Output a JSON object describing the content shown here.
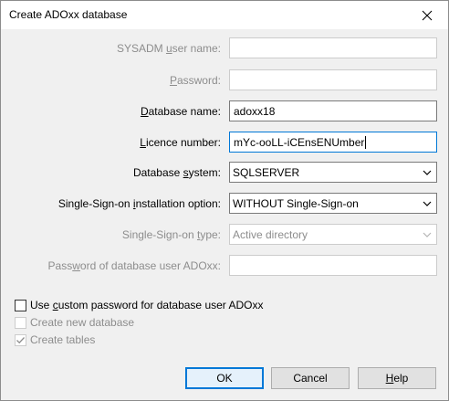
{
  "window": {
    "title": "Create ADOxx database"
  },
  "fields": {
    "sysadm_user_name": {
      "label_pre": "SYSADM ",
      "label_u": "u",
      "label_post": "ser name:",
      "value": ""
    },
    "password": {
      "label_pre": "",
      "label_u": "P",
      "label_post": "assword:",
      "value": ""
    },
    "database_name": {
      "label_pre": "",
      "label_u": "D",
      "label_post": "atabase name:",
      "value": "adoxx18"
    },
    "licence_number": {
      "label_pre": "",
      "label_u": "L",
      "label_post": "icence number:",
      "value": "mYc-ooLL-iCEnsENUmber"
    },
    "database_system": {
      "label_pre": "Database ",
      "label_u": "s",
      "label_post": "ystem:",
      "value": "SQLSERVER"
    },
    "sso_option": {
      "label_pre": "Single-Sign-on ",
      "label_u": "i",
      "label_post": "nstallation option:",
      "value": "WITHOUT Single-Sign-on"
    },
    "sso_type": {
      "label_pre": "Single-Sign-on ",
      "label_u": "t",
      "label_post": "ype:",
      "value": "Active directory"
    },
    "db_user_password": {
      "label_pre": "Pass",
      "label_u": "w",
      "label_post": "ord of database user ADOxx:",
      "value": ""
    }
  },
  "checkboxes": {
    "custom_password": {
      "label_pre": "Use ",
      "label_u": "c",
      "label_post": "ustom password for database user ADOxx",
      "checked": false
    },
    "create_new_database": {
      "label": "Create new database",
      "checked": false
    },
    "create_tables": {
      "label": "Create tables",
      "checked": true
    }
  },
  "buttons": {
    "ok": "OK",
    "cancel": "Cancel",
    "help_u": "H",
    "help_post": "elp"
  }
}
